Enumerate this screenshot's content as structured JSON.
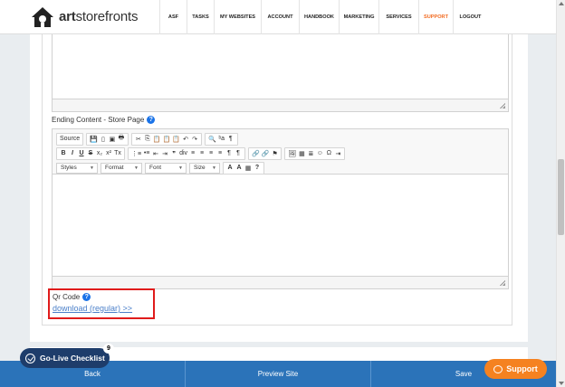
{
  "header": {
    "logo_bold": "art",
    "logo_rest": "storefronts",
    "nav": [
      {
        "label": "ASF",
        "active": false
      },
      {
        "label": "TASKS",
        "active": false
      },
      {
        "label": "MY WEBSITES",
        "active": false
      },
      {
        "label": "ACCOUNT",
        "active": false
      },
      {
        "label": "HANDBOOK",
        "active": false
      },
      {
        "label": "MARKETING",
        "active": false
      },
      {
        "label": "SERVICES",
        "active": false
      },
      {
        "label": "SUPPORT",
        "active": true
      },
      {
        "label": "LOGOUT",
        "active": false
      }
    ]
  },
  "form": {
    "ending_label": "Ending Content - Store Page",
    "help_glyph": "?",
    "qr_label": "Qr Code",
    "qr_link": "download (regular) >>"
  },
  "toolbar": {
    "row1": [
      [
        "Source"
      ],
      [
        "💾",
        "▯",
        "▣",
        "🖶"
      ],
      [
        "✂",
        "⎘",
        "📋",
        "📋",
        "📋",
        "↶",
        "↷"
      ],
      [
        "🔍",
        "ᵇa",
        "¶"
      ]
    ],
    "row2": [
      [
        "B",
        "I",
        "U",
        "S",
        "x₂",
        "x²",
        "Tx"
      ],
      [
        "⋮≡",
        "•≡",
        "⇤",
        "⇥",
        "❞",
        "div",
        "≡",
        "≡",
        "≡",
        "≡",
        "¶",
        "¶"
      ],
      [
        "🔗",
        "🔗",
        "⚑"
      ],
      [
        "🖼",
        "▦",
        "≣",
        "☺",
        "Ω",
        "⇥"
      ]
    ],
    "combos": [
      "Styles",
      "Format",
      "Font",
      "Size"
    ],
    "row3_extra": [
      "A",
      "A",
      "▦",
      "?"
    ]
  },
  "footer": {
    "back": "Back",
    "preview": "Preview Site",
    "save": "Save"
  },
  "golive": {
    "label": "Go-Live Checklist",
    "count": "9"
  },
  "support": {
    "label": "Support"
  },
  "colors": {
    "accent": "#f26b21",
    "footer": "#2b73b9",
    "golive": "#1e3d6b",
    "support": "#f58220",
    "highlight_box": "#e01b1b",
    "link": "#4a7fc9"
  }
}
